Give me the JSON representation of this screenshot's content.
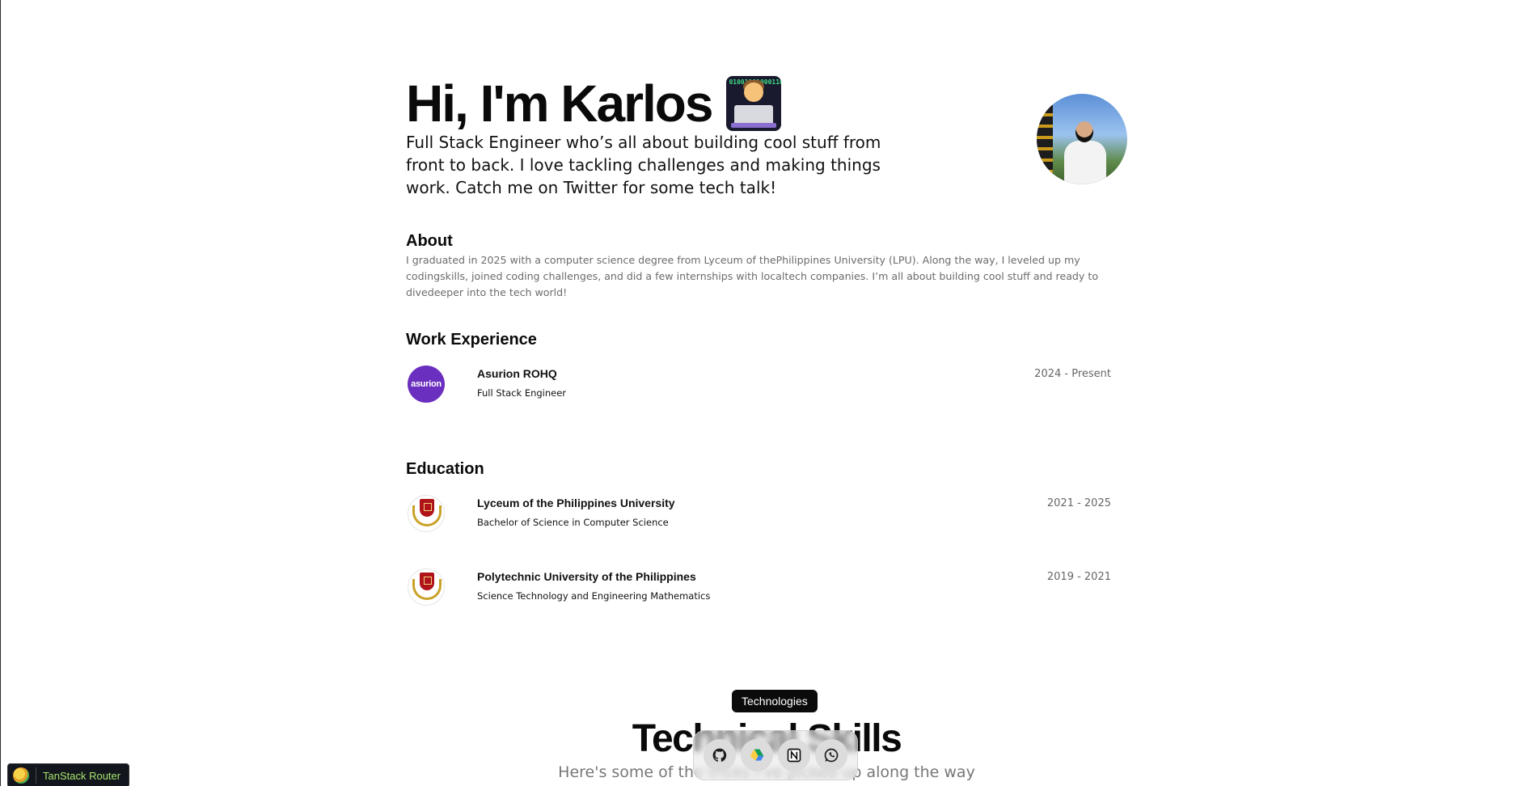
{
  "hero": {
    "title": "Hi, I'm Karlos",
    "emoji": "technologist-emoji",
    "subtitle": "Full Stack Engineer who’s all about building cool stuff from front to back. I love tackling challenges and making things work. Catch me on Twitter for some tech talk!"
  },
  "about": {
    "heading": "About",
    "text": "I graduated in 2025 with a computer science degree from Lyceum of thePhilippines University (LPU). Along the way, I leveled up my codingskills, joined coding challenges, and did a few internships with localtech companies. I’m all about building cool stuff and ready to divedeeper into the tech world!"
  },
  "work": {
    "heading": "Work Experience",
    "items": [
      {
        "logo_text": "asurion",
        "company": "Asurion ROHQ",
        "role": "Full Stack Engineer",
        "dates": "2024 - Present"
      }
    ]
  },
  "education": {
    "heading": "Education",
    "items": [
      {
        "school": "Lyceum of the Philippines University",
        "degree": "Bachelor of Science in Computer Science",
        "dates": "2021 - 2025"
      },
      {
        "school": "Polytechnic University of the Philippines",
        "degree": "Science Technology and Engineering Mathematics",
        "dates": "2019 - 2021"
      }
    ]
  },
  "skills": {
    "heading": "Technical Skills",
    "subtitle": "Here's some of the tricks I've picked up along the way"
  },
  "dock": {
    "tooltip": "Technologies",
    "items": [
      "github-icon",
      "google-drive-icon",
      "notion-icon",
      "whatsapp-icon"
    ]
  },
  "devtools": {
    "label": "TanStack Router"
  },
  "colors": {
    "asurion_purple": "#6a2fbf",
    "school_red": "#b0141a",
    "devtools_green": "#a6e36e"
  }
}
